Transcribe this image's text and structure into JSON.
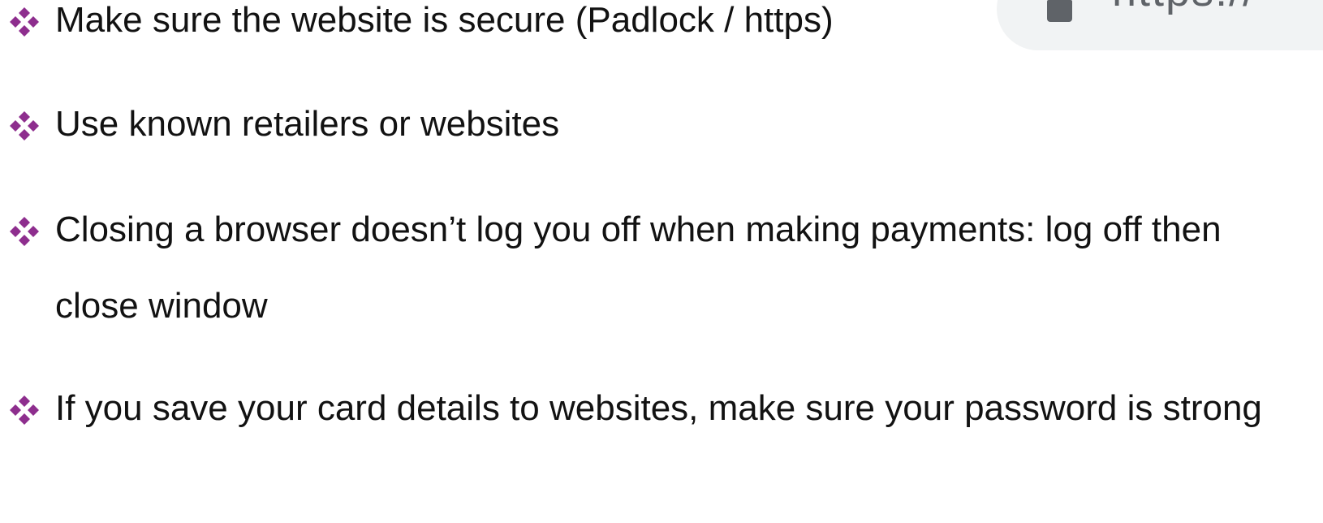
{
  "address_bar": {
    "url_text": "https://"
  },
  "colors": {
    "bullet": "#8e2e8e",
    "text": "#121212",
    "address_bar_bg": "#f1f3f4",
    "address_bar_text": "#5f6368"
  },
  "bullets": [
    {
      "icon": "four-diamond-bullet-icon",
      "text": "Make sure the website is secure (Padlock / https)"
    },
    {
      "icon": "four-diamond-bullet-icon",
      "text": "Use known retailers or websites"
    },
    {
      "icon": "four-diamond-bullet-icon",
      "text": "Closing a browser doesn’t log you off when making payments: log off then close window"
    },
    {
      "icon": "four-diamond-bullet-icon",
      "text": "If you save your card details to websites, make sure your password is strong"
    }
  ]
}
